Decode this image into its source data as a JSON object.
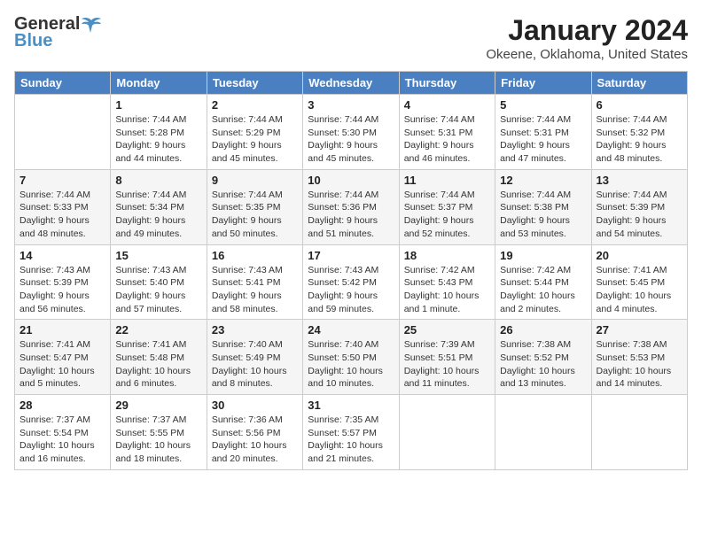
{
  "logo": {
    "general": "General",
    "blue": "Blue"
  },
  "title": "January 2024",
  "subtitle": "Okeene, Oklahoma, United States",
  "days_of_week": [
    "Sunday",
    "Monday",
    "Tuesday",
    "Wednesday",
    "Thursday",
    "Friday",
    "Saturday"
  ],
  "weeks": [
    [
      {
        "day": "",
        "sunrise": "",
        "sunset": "",
        "daylight": ""
      },
      {
        "day": "1",
        "sunrise": "Sunrise: 7:44 AM",
        "sunset": "Sunset: 5:28 PM",
        "daylight": "Daylight: 9 hours and 44 minutes."
      },
      {
        "day": "2",
        "sunrise": "Sunrise: 7:44 AM",
        "sunset": "Sunset: 5:29 PM",
        "daylight": "Daylight: 9 hours and 45 minutes."
      },
      {
        "day": "3",
        "sunrise": "Sunrise: 7:44 AM",
        "sunset": "Sunset: 5:30 PM",
        "daylight": "Daylight: 9 hours and 45 minutes."
      },
      {
        "day": "4",
        "sunrise": "Sunrise: 7:44 AM",
        "sunset": "Sunset: 5:31 PM",
        "daylight": "Daylight: 9 hours and 46 minutes."
      },
      {
        "day": "5",
        "sunrise": "Sunrise: 7:44 AM",
        "sunset": "Sunset: 5:31 PM",
        "daylight": "Daylight: 9 hours and 47 minutes."
      },
      {
        "day": "6",
        "sunrise": "Sunrise: 7:44 AM",
        "sunset": "Sunset: 5:32 PM",
        "daylight": "Daylight: 9 hours and 48 minutes."
      }
    ],
    [
      {
        "day": "7",
        "sunrise": "Sunrise: 7:44 AM",
        "sunset": "Sunset: 5:33 PM",
        "daylight": "Daylight: 9 hours and 48 minutes."
      },
      {
        "day": "8",
        "sunrise": "Sunrise: 7:44 AM",
        "sunset": "Sunset: 5:34 PM",
        "daylight": "Daylight: 9 hours and 49 minutes."
      },
      {
        "day": "9",
        "sunrise": "Sunrise: 7:44 AM",
        "sunset": "Sunset: 5:35 PM",
        "daylight": "Daylight: 9 hours and 50 minutes."
      },
      {
        "day": "10",
        "sunrise": "Sunrise: 7:44 AM",
        "sunset": "Sunset: 5:36 PM",
        "daylight": "Daylight: 9 hours and 51 minutes."
      },
      {
        "day": "11",
        "sunrise": "Sunrise: 7:44 AM",
        "sunset": "Sunset: 5:37 PM",
        "daylight": "Daylight: 9 hours and 52 minutes."
      },
      {
        "day": "12",
        "sunrise": "Sunrise: 7:44 AM",
        "sunset": "Sunset: 5:38 PM",
        "daylight": "Daylight: 9 hours and 53 minutes."
      },
      {
        "day": "13",
        "sunrise": "Sunrise: 7:44 AM",
        "sunset": "Sunset: 5:39 PM",
        "daylight": "Daylight: 9 hours and 54 minutes."
      }
    ],
    [
      {
        "day": "14",
        "sunrise": "Sunrise: 7:43 AM",
        "sunset": "Sunset: 5:39 PM",
        "daylight": "Daylight: 9 hours and 56 minutes."
      },
      {
        "day": "15",
        "sunrise": "Sunrise: 7:43 AM",
        "sunset": "Sunset: 5:40 PM",
        "daylight": "Daylight: 9 hours and 57 minutes."
      },
      {
        "day": "16",
        "sunrise": "Sunrise: 7:43 AM",
        "sunset": "Sunset: 5:41 PM",
        "daylight": "Daylight: 9 hours and 58 minutes."
      },
      {
        "day": "17",
        "sunrise": "Sunrise: 7:43 AM",
        "sunset": "Sunset: 5:42 PM",
        "daylight": "Daylight: 9 hours and 59 minutes."
      },
      {
        "day": "18",
        "sunrise": "Sunrise: 7:42 AM",
        "sunset": "Sunset: 5:43 PM",
        "daylight": "Daylight: 10 hours and 1 minute."
      },
      {
        "day": "19",
        "sunrise": "Sunrise: 7:42 AM",
        "sunset": "Sunset: 5:44 PM",
        "daylight": "Daylight: 10 hours and 2 minutes."
      },
      {
        "day": "20",
        "sunrise": "Sunrise: 7:41 AM",
        "sunset": "Sunset: 5:45 PM",
        "daylight": "Daylight: 10 hours and 4 minutes."
      }
    ],
    [
      {
        "day": "21",
        "sunrise": "Sunrise: 7:41 AM",
        "sunset": "Sunset: 5:47 PM",
        "daylight": "Daylight: 10 hours and 5 minutes."
      },
      {
        "day": "22",
        "sunrise": "Sunrise: 7:41 AM",
        "sunset": "Sunset: 5:48 PM",
        "daylight": "Daylight: 10 hours and 6 minutes."
      },
      {
        "day": "23",
        "sunrise": "Sunrise: 7:40 AM",
        "sunset": "Sunset: 5:49 PM",
        "daylight": "Daylight: 10 hours and 8 minutes."
      },
      {
        "day": "24",
        "sunrise": "Sunrise: 7:40 AM",
        "sunset": "Sunset: 5:50 PM",
        "daylight": "Daylight: 10 hours and 10 minutes."
      },
      {
        "day": "25",
        "sunrise": "Sunrise: 7:39 AM",
        "sunset": "Sunset: 5:51 PM",
        "daylight": "Daylight: 10 hours and 11 minutes."
      },
      {
        "day": "26",
        "sunrise": "Sunrise: 7:38 AM",
        "sunset": "Sunset: 5:52 PM",
        "daylight": "Daylight: 10 hours and 13 minutes."
      },
      {
        "day": "27",
        "sunrise": "Sunrise: 7:38 AM",
        "sunset": "Sunset: 5:53 PM",
        "daylight": "Daylight: 10 hours and 14 minutes."
      }
    ],
    [
      {
        "day": "28",
        "sunrise": "Sunrise: 7:37 AM",
        "sunset": "Sunset: 5:54 PM",
        "daylight": "Daylight: 10 hours and 16 minutes."
      },
      {
        "day": "29",
        "sunrise": "Sunrise: 7:37 AM",
        "sunset": "Sunset: 5:55 PM",
        "daylight": "Daylight: 10 hours and 18 minutes."
      },
      {
        "day": "30",
        "sunrise": "Sunrise: 7:36 AM",
        "sunset": "Sunset: 5:56 PM",
        "daylight": "Daylight: 10 hours and 20 minutes."
      },
      {
        "day": "31",
        "sunrise": "Sunrise: 7:35 AM",
        "sunset": "Sunset: 5:57 PM",
        "daylight": "Daylight: 10 hours and 21 minutes."
      },
      {
        "day": "",
        "sunrise": "",
        "sunset": "",
        "daylight": ""
      },
      {
        "day": "",
        "sunrise": "",
        "sunset": "",
        "daylight": ""
      },
      {
        "day": "",
        "sunrise": "",
        "sunset": "",
        "daylight": ""
      }
    ]
  ]
}
